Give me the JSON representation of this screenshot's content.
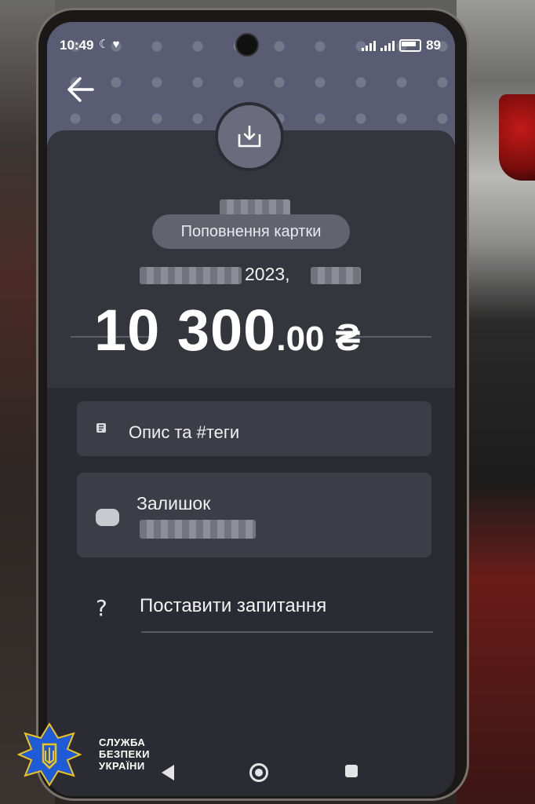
{
  "status_bar": {
    "time": "10:49",
    "battery": "89"
  },
  "transaction": {
    "type_label": "Поповнення картки",
    "date_year": "2023,",
    "amount_main": "10 300",
    "amount_cents": ".00",
    "currency_symbol": "₴"
  },
  "actions": {
    "description_label": "Опис та #теги",
    "balance_label": "Залишок",
    "question_label": "Поставити запитання",
    "question_icon": "?"
  },
  "watermark": {
    "line1": "СЛУЖБА",
    "line2": "БЕЗПЕКИ",
    "line3": "УКРАЇНИ"
  },
  "colors": {
    "screen_bg": "#2b2c33",
    "header_bg": "#5a5c74",
    "card_bg": "#3c3d47",
    "sbu_blue": "#1f5bd6",
    "sbu_gold": "#f0c419"
  }
}
